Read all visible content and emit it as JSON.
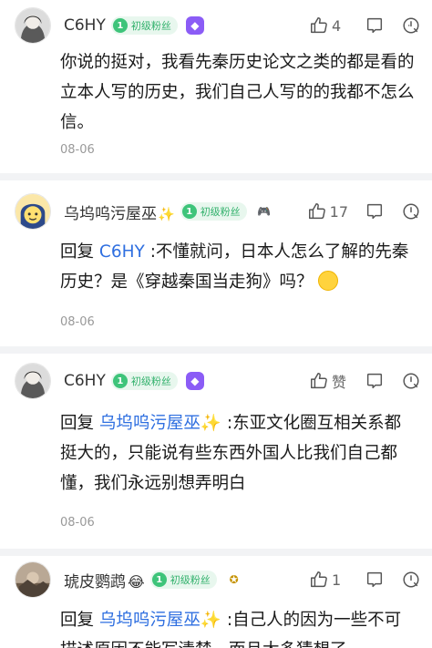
{
  "comments": [
    {
      "user": "C6HY",
      "badge_level": "1",
      "badge_text": "初级粉丝",
      "extra_icon": "purple-medal-icon",
      "likes": "4",
      "reply_prefix": "",
      "reply_to": "",
      "text": "你说的挺对，我看先秦历史论文之类的都是看的立本人写的历史，我们自己人写的的我都不怎么信。",
      "date": "08-06"
    },
    {
      "user": "乌坞呜污屋巫",
      "user_suffix": "✨",
      "badge_level": "1",
      "badge_text": "初级粉丝",
      "extra_icon": "gamepad-icon",
      "likes": "17",
      "reply_prefix": "回复",
      "reply_to": "C6HY",
      "text": ":不懂就问，日本人怎么了解的先秦历史？是《穿越秦国当走狗》吗？",
      "date": "08-06"
    },
    {
      "user": "C6HY",
      "badge_level": "1",
      "badge_text": "初级粉丝",
      "extra_icon": "purple-medal-icon",
      "likes": "赞",
      "reply_prefix": "回复",
      "reply_to": "乌坞呜污屋巫✨",
      "text": ":东亚文化圈互相关系都挺大的，只能说有些东西外国人比我们自己都懂，我们永远别想弄明白",
      "date": "08-06"
    },
    {
      "user": "琥皮鹦鹉",
      "user_suffix": "😂",
      "badge_level": "1",
      "badge_text": "初级粉丝",
      "extra_icon": "gold-medal-icon",
      "likes": "1",
      "reply_prefix": "回复",
      "reply_to": "乌坞呜污屋巫✨",
      "text": ":自己人的因为一些不可描述原因不能写清楚，而且太多猜想了",
      "date": ""
    }
  ]
}
